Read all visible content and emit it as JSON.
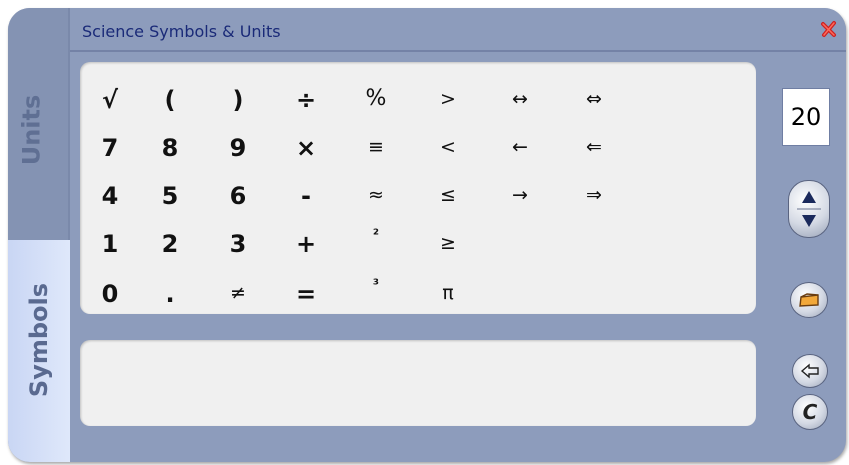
{
  "window": {
    "title": "Science Symbols & Units"
  },
  "tabs": [
    {
      "label": "Units",
      "active": false
    },
    {
      "label": "Symbols",
      "active": true
    }
  ],
  "keypad": {
    "rows": [
      [
        "√",
        "(",
        ")",
        "÷",
        "%",
        ">",
        "↔",
        "⇔"
      ],
      [
        "7",
        "8",
        "9",
        "×",
        "≡",
        "<",
        "←",
        "⇐"
      ],
      [
        "4",
        "5",
        "6",
        "-",
        "≈",
        "≤",
        "→",
        "⇒"
      ],
      [
        "1",
        "2",
        "3",
        "+",
        "²",
        "≥"
      ],
      [
        "0",
        ".",
        "≠",
        "=",
        "³",
        "π"
      ]
    ]
  },
  "display": {
    "value": ""
  },
  "font_size": {
    "value": "20"
  },
  "icons": {
    "close": "close-icon",
    "spinner": "up-down-spinner-icon",
    "insert": "insert-icon",
    "backspace": "backspace-arrow-icon",
    "clear": "clear-c-icon"
  },
  "colors": {
    "frame": "#8d9cbc",
    "title_text": "#1a2a78",
    "panel": "#f0f0f0",
    "active_tab": "#d7e2f9",
    "close": "#cc2222"
  }
}
